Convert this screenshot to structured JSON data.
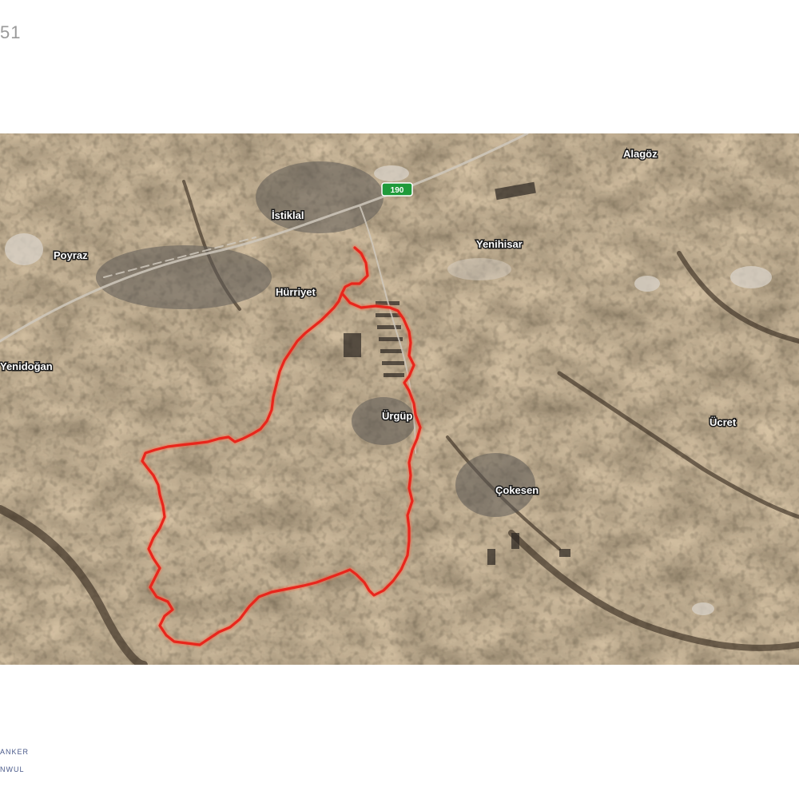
{
  "page": {
    "corner_number": "51"
  },
  "map": {
    "route_color": "#e8261c",
    "places": [
      {
        "id": "alagoz",
        "label": "Alagöz"
      },
      {
        "id": "istiklal",
        "label": "İstiklal"
      },
      {
        "id": "yenihisar",
        "label": "Yenihisar"
      },
      {
        "id": "poyraz",
        "label": "Poyraz"
      },
      {
        "id": "hurriyet",
        "label": "Hürriyet"
      },
      {
        "id": "yenidogan",
        "label": "Yenidoğan"
      },
      {
        "id": "urgup",
        "label": "Ürgüp"
      },
      {
        "id": "ucret",
        "label": "Ücret"
      },
      {
        "id": "cokek",
        "label": "Çokesen"
      }
    ],
    "road_shield": {
      "label": "190",
      "color": "#1f9a3a"
    }
  },
  "footer": {
    "line1": "ANKER",
    "line2": "NWUL"
  }
}
